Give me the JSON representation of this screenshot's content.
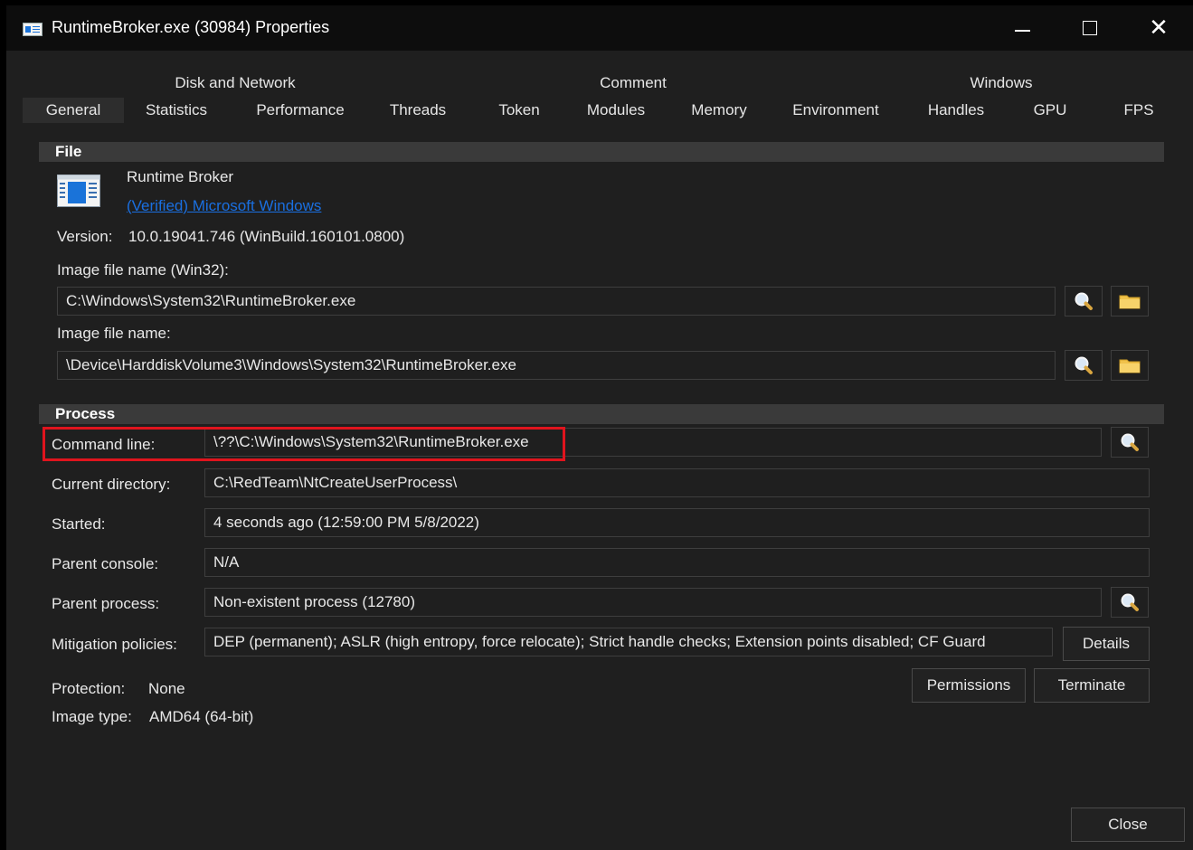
{
  "window": {
    "title": "RuntimeBroker.exe (30984) Properties"
  },
  "tabs": {
    "row1": [
      {
        "label": "Disk and Network"
      },
      {
        "label": "Comment"
      },
      {
        "label": "Windows"
      }
    ],
    "row2": [
      {
        "label": "General",
        "active": true
      },
      {
        "label": "Statistics"
      },
      {
        "label": "Performance"
      },
      {
        "label": "Threads"
      },
      {
        "label": "Token"
      },
      {
        "label": "Modules"
      },
      {
        "label": "Memory"
      },
      {
        "label": "Environment"
      },
      {
        "label": "Handles"
      },
      {
        "label": "GPU"
      },
      {
        "label": "FPS"
      }
    ]
  },
  "file": {
    "header": "File",
    "product_name": "Runtime Broker",
    "company_link": "(Verified) Microsoft Windows",
    "version_label": "Version:",
    "version_value": "10.0.19041.746 (WinBuild.160101.0800)",
    "image_win32_label": "Image file name (Win32):",
    "image_win32_value": "C:\\Windows\\System32\\RuntimeBroker.exe",
    "image_label": "Image file name:",
    "image_value": "\\Device\\HarddiskVolume3\\Windows\\System32\\RuntimeBroker.exe"
  },
  "process": {
    "header": "Process",
    "command_line_label": "Command line:",
    "command_line_value": "\\??\\C:\\Windows\\System32\\RuntimeBroker.exe",
    "current_directory_label": "Current directory:",
    "current_directory_value": "C:\\RedTeam\\NtCreateUserProcess\\",
    "started_label": "Started:",
    "started_value": "4 seconds ago (12:59:00 PM 5/8/2022)",
    "parent_console_label": "Parent console:",
    "parent_console_value": "N/A",
    "parent_process_label": "Parent process:",
    "parent_process_value": "Non-existent process (12780)",
    "mitigation_label": "Mitigation policies:",
    "mitigation_value": "DEP (permanent); ASLR (high entropy, force relocate); Strict handle checks; Extension points disabled; CF Guard",
    "details_button": "Details",
    "protection_label": "Protection:",
    "protection_value": "None",
    "image_type_label": "Image type:",
    "image_type_value": "AMD64 (64-bit)",
    "permissions_button": "Permissions",
    "terminate_button": "Terminate"
  },
  "footer": {
    "close_button": "Close"
  },
  "colors": {
    "background": "#1f1f1f",
    "titlebar": "#0d0d0d",
    "section_header": "#3a3a3a",
    "link": "#1a6fe0",
    "highlight_border": "#e0141d"
  }
}
